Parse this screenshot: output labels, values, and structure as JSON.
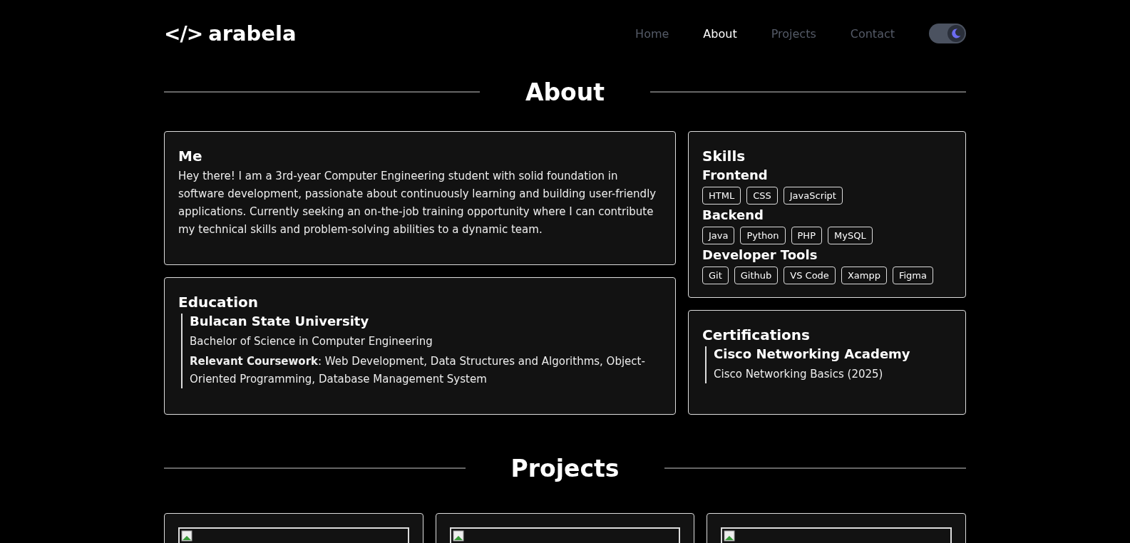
{
  "header": {
    "logo_mark": "</>",
    "logo_text": "arabela",
    "nav": [
      {
        "label": "Home",
        "selected": false
      },
      {
        "label": "About",
        "selected": true
      },
      {
        "label": "Projects",
        "selected": false
      },
      {
        "label": "Contact",
        "selected": false
      }
    ],
    "dark_mode": {
      "on": true
    }
  },
  "about": {
    "title": "About",
    "me": {
      "title": "Me",
      "text": "Hey there! I am a 3rd-year Computer Engineering student with solid foundation in software development, passionate about continuously learning and building user-friendly applications. Currently seeking an on-the-job training opportunity where I can contribute my technical skills and problem-solving abilities to a dynamic team."
    },
    "education": {
      "title": "Education",
      "school": "Bulacan State University",
      "degree": "Bachelor of Science in Computer Engineering",
      "coursework": "**Relevant Coursework**: Web Development, Data Structures and Algorithms, Object-Oriented Programming, Database Management System"
    },
    "skills": {
      "title": "Skills",
      "groups": [
        {
          "name": "Frontend",
          "tags": [
            "HTML",
            "CSS",
            "JavaScript"
          ]
        },
        {
          "name": "Backend",
          "tags": [
            "Java",
            "Python",
            "PHP",
            "MySQL"
          ]
        },
        {
          "name": "Developer Tools",
          "tags": [
            "Git",
            "Github",
            "VS Code",
            "Xampp",
            "Figma"
          ]
        }
      ]
    },
    "certifications": {
      "title": "Certifications",
      "items": [
        {
          "issuer": "Cisco Networking Academy",
          "name": "Cisco Networking Basics (2025)"
        }
      ]
    }
  },
  "projects": {
    "title": "Projects",
    "cards": [
      {
        "kind": "image"
      },
      {
        "kind": "image"
      },
      {
        "kind": "image"
      }
    ]
  }
}
